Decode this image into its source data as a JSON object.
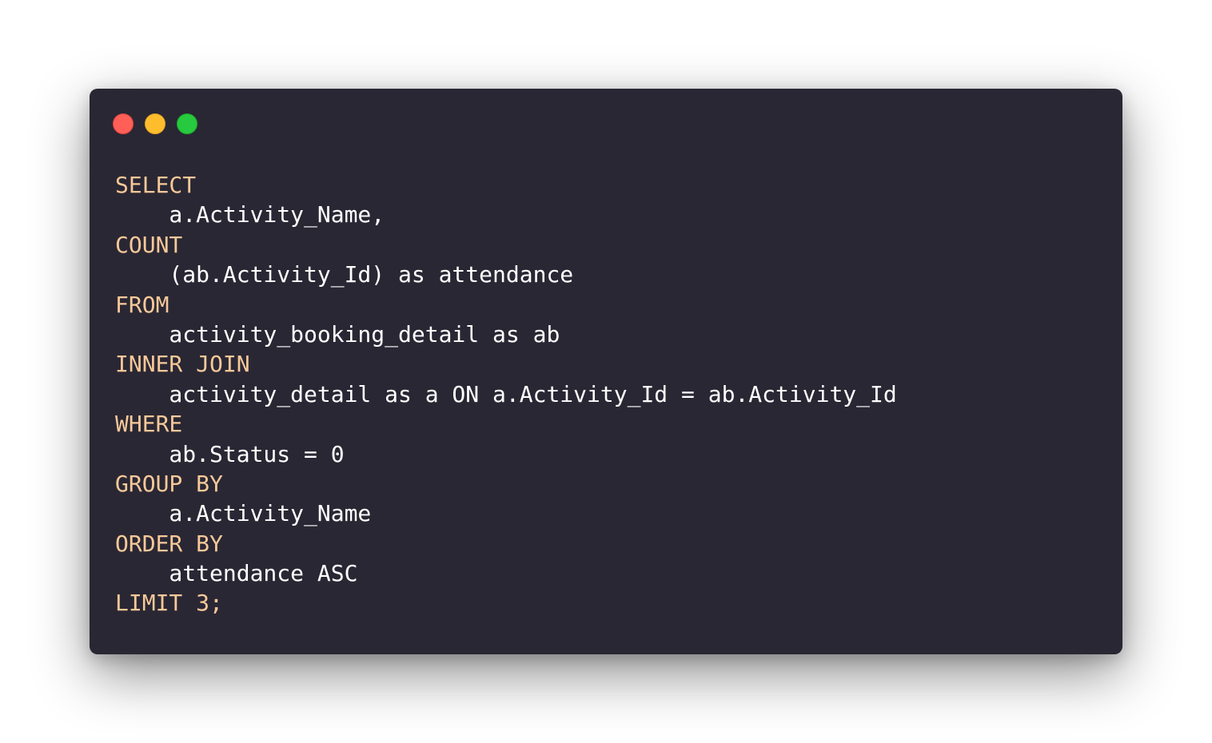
{
  "window": {
    "controls": [
      {
        "name": "close",
        "color": "#ff5f56"
      },
      {
        "name": "minimize",
        "color": "#ffbd2e"
      },
      {
        "name": "zoom",
        "color": "#27c93f"
      }
    ]
  },
  "code": {
    "lines": [
      {
        "keyword": "SELECT",
        "text": ""
      },
      {
        "keyword": "",
        "text": "    a.Activity_Name,"
      },
      {
        "keyword": "COUNT",
        "text": ""
      },
      {
        "keyword": "",
        "text": "    (ab.Activity_Id) as attendance"
      },
      {
        "keyword": "FROM",
        "text": ""
      },
      {
        "keyword": "",
        "text": "    activity_booking_detail as ab"
      },
      {
        "keyword": "INNER JOIN",
        "text": ""
      },
      {
        "keyword": "",
        "text": "    activity_detail as a ON a.Activity_Id = ab.Activity_Id"
      },
      {
        "keyword": "WHERE",
        "text": ""
      },
      {
        "keyword": "",
        "text": "    ab.Status = 0"
      },
      {
        "keyword": "GROUP BY",
        "text": ""
      },
      {
        "keyword": "",
        "text": "    a.Activity_Name"
      },
      {
        "keyword": "ORDER BY",
        "text": ""
      },
      {
        "keyword": "",
        "text": "    attendance ASC"
      },
      {
        "keyword": "LIMIT 3",
        "text": ";"
      }
    ]
  },
  "colors": {
    "background": "#2a2734",
    "keyword": "#f7c999",
    "text": "#ffffff"
  }
}
